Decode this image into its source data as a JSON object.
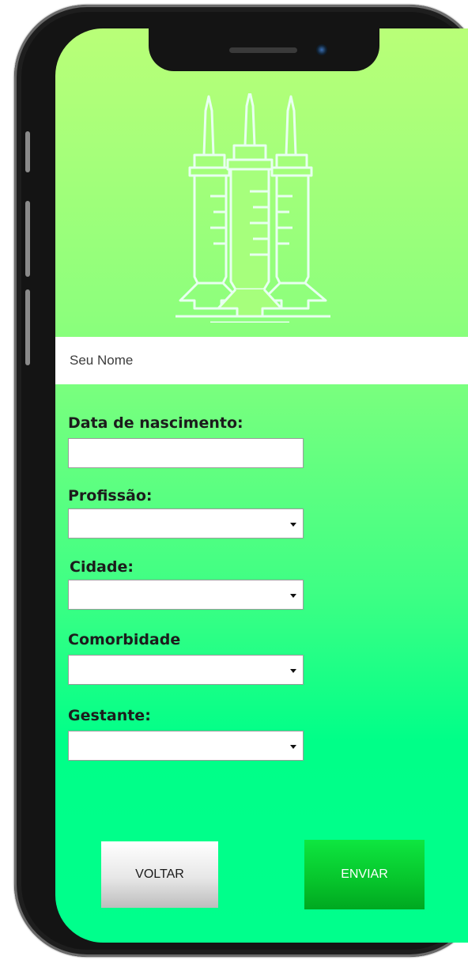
{
  "form": {
    "name_placeholder": "Seu Nome",
    "birth_label": "Data de nascimento:",
    "birth_value": "",
    "profession_label": "Profissão:",
    "profession_value": "",
    "city_label": "Cidade:",
    "city_value": "",
    "comorbidity_label": "Comorbidade",
    "comorbidity_value": "",
    "pregnant_label": "Gestante:",
    "pregnant_value": ""
  },
  "buttons": {
    "back_label": "VOLTAR",
    "send_label": "ENVIAR"
  },
  "icons": {
    "logo": "syringes-icon",
    "select_arrow": "caret-down-icon"
  },
  "colors": {
    "gradient_top": "#b9ff78",
    "gradient_bottom": "#00ff8c",
    "send_button": "#06c42b",
    "back_button": "#e7e7e7",
    "logo_stroke": "#e8fff0"
  }
}
